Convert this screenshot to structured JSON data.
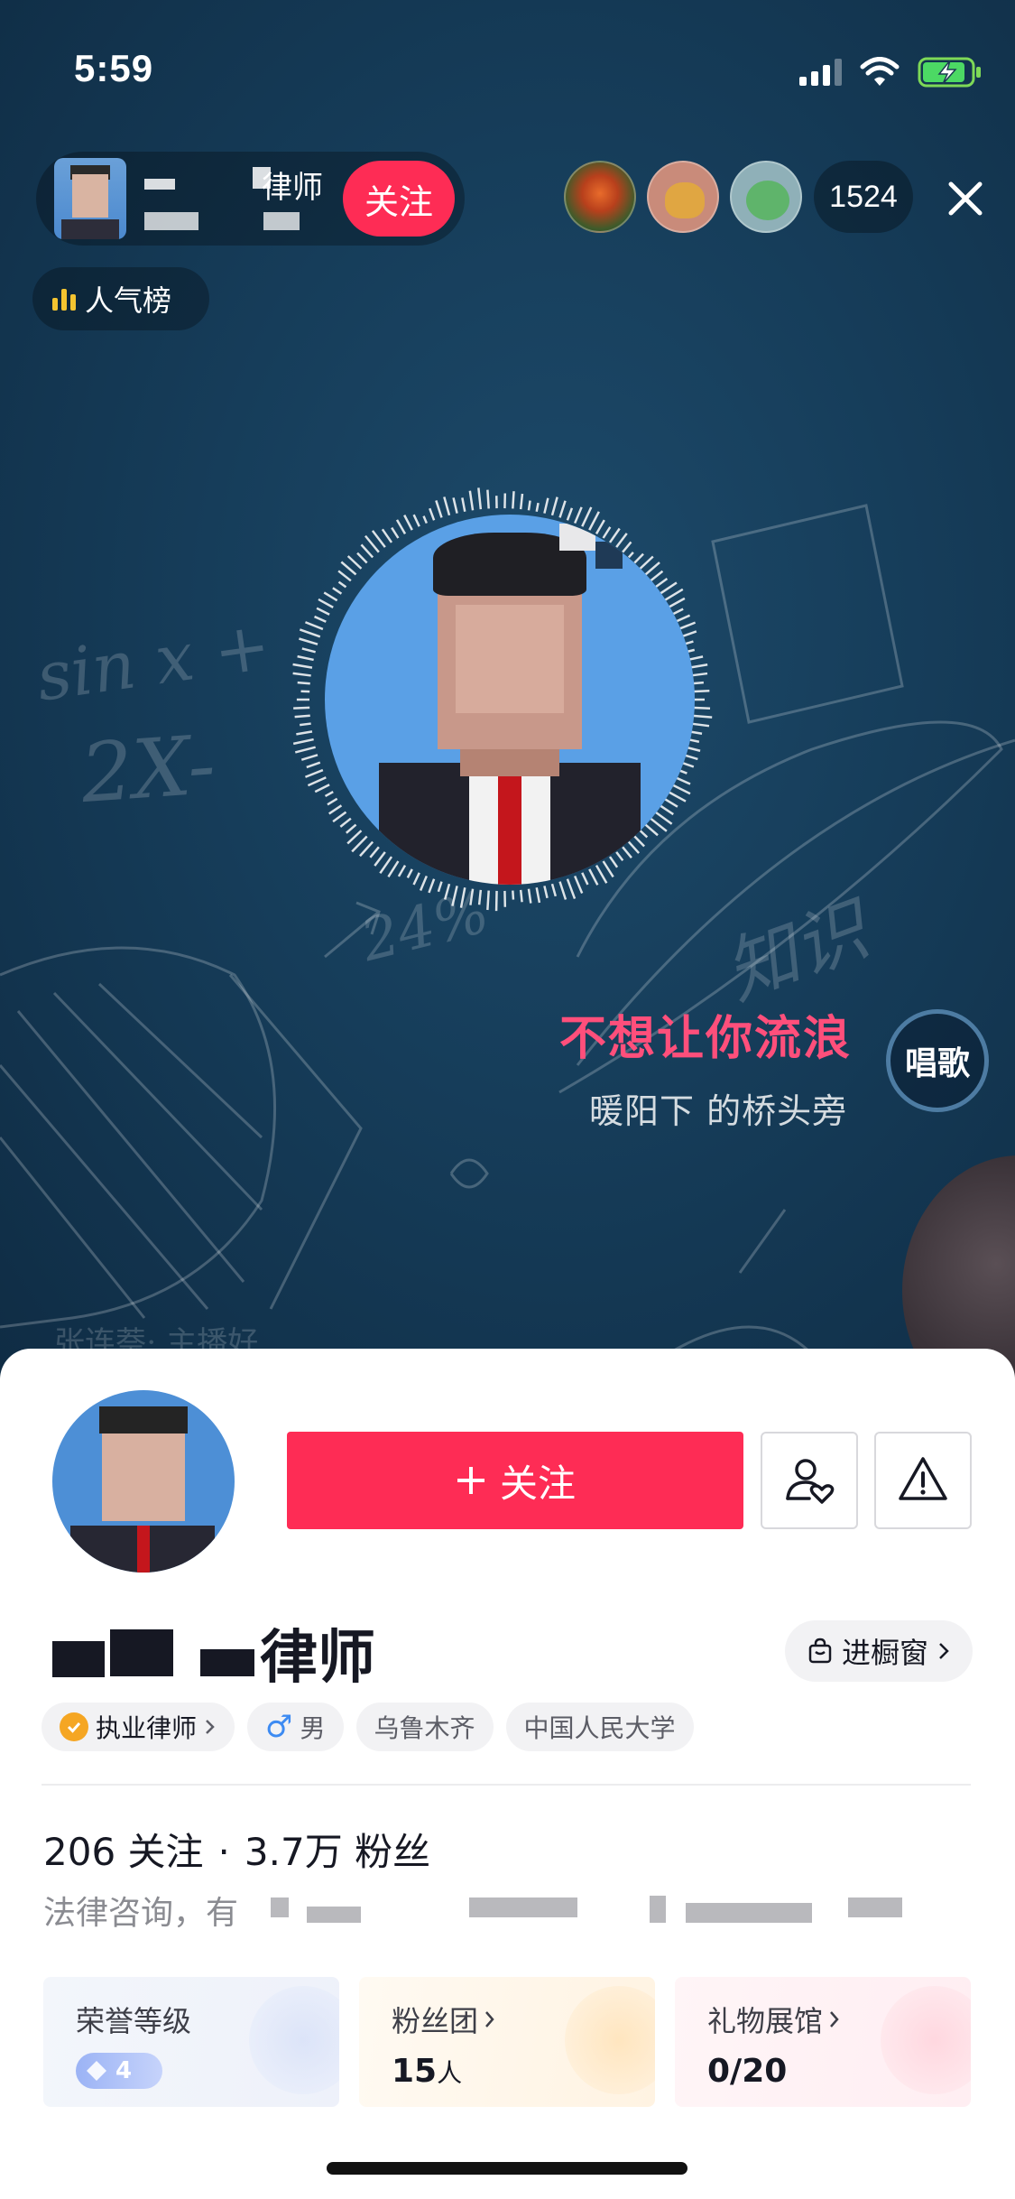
{
  "status_bar": {
    "time": "5:59"
  },
  "live_header": {
    "anchor_name": "律师",
    "follow_label": "关注",
    "viewer_count": "1524",
    "rank_label": "人气榜"
  },
  "song": {
    "title": "不想让你流浪",
    "lyric": "暖阳下 的桥头旁",
    "sing_label": "唱歌"
  },
  "chalkboard": {
    "words": [
      "sin x +",
      "2X-",
      "24%",
      "知识",
      "张连萘: 主播好"
    ]
  },
  "profile": {
    "follow_button": "关注",
    "name_suffix": "律师",
    "showcase_label": "进橱窗",
    "tags": [
      {
        "label": "执业律师"
      },
      {
        "label": "男",
        "symbol": "♂"
      },
      {
        "label": "乌鲁木齐"
      },
      {
        "label": "中国人民大学"
      }
    ],
    "following_count": "206",
    "following_label": "关注",
    "separator": "·",
    "followers_count": "3.7万",
    "followers_label": "粉丝",
    "bio_prefix": "法律咨询，有",
    "cards": [
      {
        "title": "荣誉等级",
        "level": "4"
      },
      {
        "title": "粉丝团",
        "value": "15",
        "unit": "人"
      },
      {
        "title": "礼物展馆",
        "value": "0/20"
      }
    ]
  },
  "colors": {
    "accent": "#fe2c55",
    "song_title": "#ff4f7b",
    "stage_bg": "#163d5a"
  },
  "icons": {
    "close": "close-icon",
    "share": "person-heart-icon",
    "report": "warning-icon",
    "showcase": "shopping-bag-icon",
    "verified": "verified-check-icon"
  }
}
